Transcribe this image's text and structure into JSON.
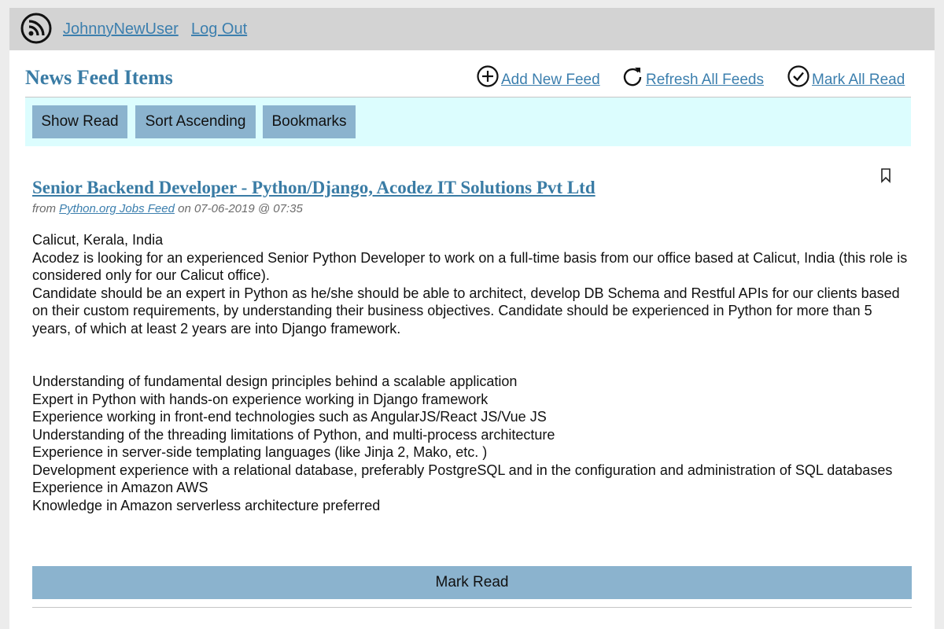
{
  "header": {
    "logo_icon": "rss-icon",
    "username": "JohnnyNewUser",
    "logout_label": "Log Out"
  },
  "page": {
    "title": "News Feed Items",
    "actions": {
      "add_feed": {
        "label": "Add New Feed",
        "icon": "plus-circle-icon"
      },
      "refresh_all": {
        "label": "Refresh All Feeds",
        "icon": "refresh-icon"
      },
      "mark_all_read": {
        "label": "Mark All Read",
        "icon": "check-circle-icon"
      }
    }
  },
  "toolbar": {
    "show_read_label": "Show Read",
    "sort_label": "Sort Ascending",
    "bookmarks_label": "Bookmarks"
  },
  "item": {
    "title": "Senior Backend Developer - Python/Django, Acodez IT Solutions Pvt Ltd",
    "meta_from": "from",
    "source": "Python.org Jobs Feed",
    "meta_on": "on 07-06-2019 @ 07:35",
    "bookmark_icon": "bookmark-icon",
    "body_lines": [
      "Calicut, Kerala, India",
      "Acodez is looking for an experienced Senior Python Developer to work on a full-time basis from our office based at Calicut, India (this role is considered only for our Calicut office).",
      "Candidate should be an expert in Python as he/she should be able to architect, develop DB Schema and Restful APIs for our clients based on their custom requirements, by understanding their business objectives. Candidate should be experienced in Python for more than 5 years, of which at least 2 years are into Django framework."
    ],
    "requirements": [
      "Understanding of fundamental design principles behind a scalable application",
      "Expert in Python with hands-on experience working in Django framework",
      "Experience working in front-end technologies such as AngularJS/React JS/Vue JS",
      "Understanding of the threading limitations of Python, and multi-process architecture",
      "Experience in server-side templating languages (like Jinja 2, Mako, etc. )",
      "Development experience with a relational database, preferably PostgreSQL and in the configuration and administration of SQL databases",
      "Experience in Amazon AWS",
      "Knowledge in Amazon serverless architecture preferred"
    ],
    "mark_read_label": "Mark Read"
  },
  "colors": {
    "accent": "#3a7ca5",
    "button": "#8bb3ce",
    "toolbar_bg": "#dcfdfe",
    "header_bg": "#d3d3d3"
  }
}
